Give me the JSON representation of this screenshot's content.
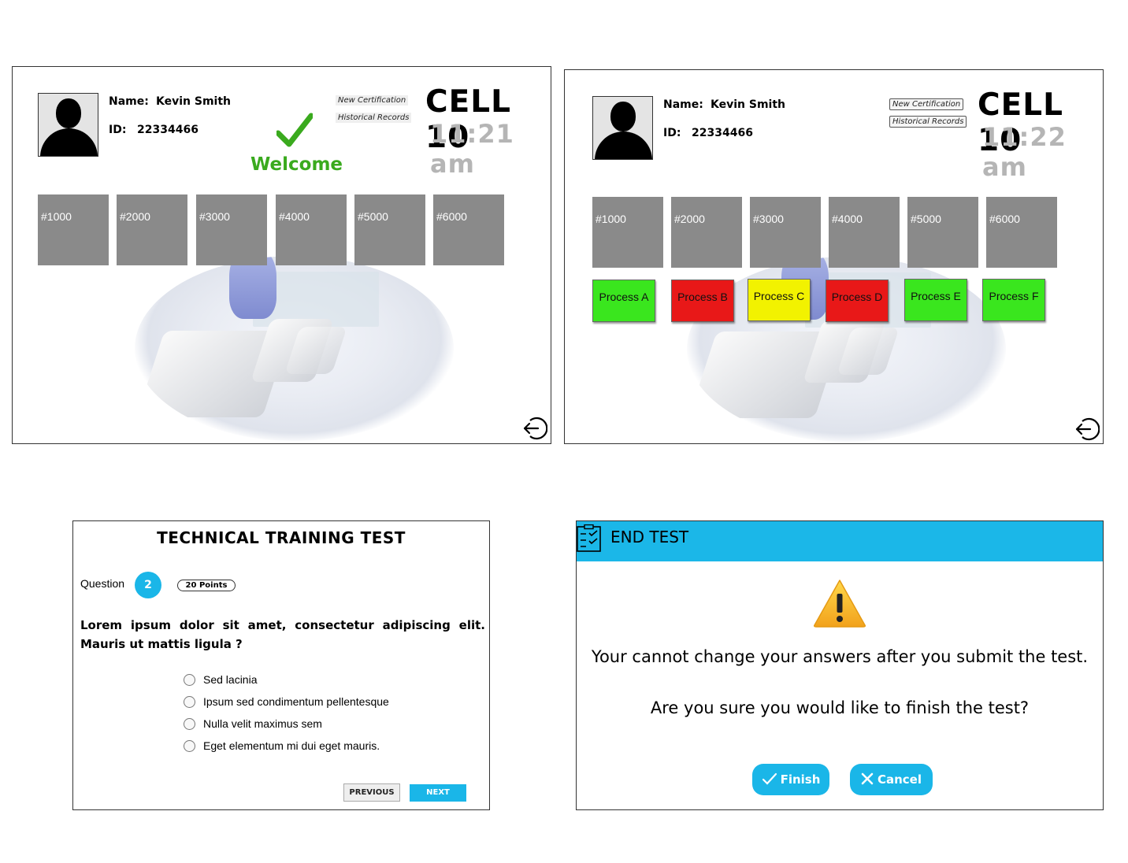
{
  "screen1": {
    "name_label": "Name:",
    "name_value": "Kevin Smith",
    "id_label": "ID:",
    "id_value": "22334466",
    "link_new_cert": "New Certification",
    "link_history": "Historical Records",
    "cell": "CELL 10",
    "time": "11:21 am",
    "welcome": "Welcome",
    "tiles": [
      "#1000",
      "#2000",
      "#3000",
      "#4000",
      "#5000",
      "#6000"
    ]
  },
  "screen2": {
    "name_label": "Name:",
    "name_value": "Kevin Smith",
    "id_label": "ID:",
    "id_value": "22334466",
    "link_new_cert": "New Certification",
    "link_history": "Historical Records",
    "cell": "CELL 10",
    "time": "11:22 am",
    "tiles": [
      "#1000",
      "#2000",
      "#3000",
      "#4000",
      "#5000",
      "#6000"
    ],
    "processes": [
      {
        "label": "Process A",
        "color": "#3ae61e"
      },
      {
        "label": "Process B",
        "color": "#e81818"
      },
      {
        "label": "Process C",
        "color": "#f2f200"
      },
      {
        "label": "Process D",
        "color": "#e81818"
      },
      {
        "label": "Process E",
        "color": "#3ae61e"
      },
      {
        "label": "Process F",
        "color": "#3ae61e"
      }
    ]
  },
  "test": {
    "title": "TECHNICAL TRAINING TEST",
    "question_label": "Question",
    "question_number": "2",
    "points": "20 Points",
    "question_text": "Lorem ipsum dolor sit amet, consectetur adipiscing elit. Mauris ut mattis ligula ?",
    "options": [
      "Sed lacinia",
      "Ipsum sed condimentum pellentesque",
      "Nulla velit maximus sem",
      "Eget elementum mi dui eget mauris."
    ],
    "previous_label": "PREVIOUS",
    "next_label": "NEXT",
    "accent": "#1ab6e8"
  },
  "end_test": {
    "title": "END TEST",
    "message1": "Your cannot change your answers after you submit the test.",
    "message2": "Are you sure you would like to finish the test?",
    "finish_label": "Finish",
    "cancel_label": "Cancel",
    "bar_color": "#1bb7e8"
  }
}
